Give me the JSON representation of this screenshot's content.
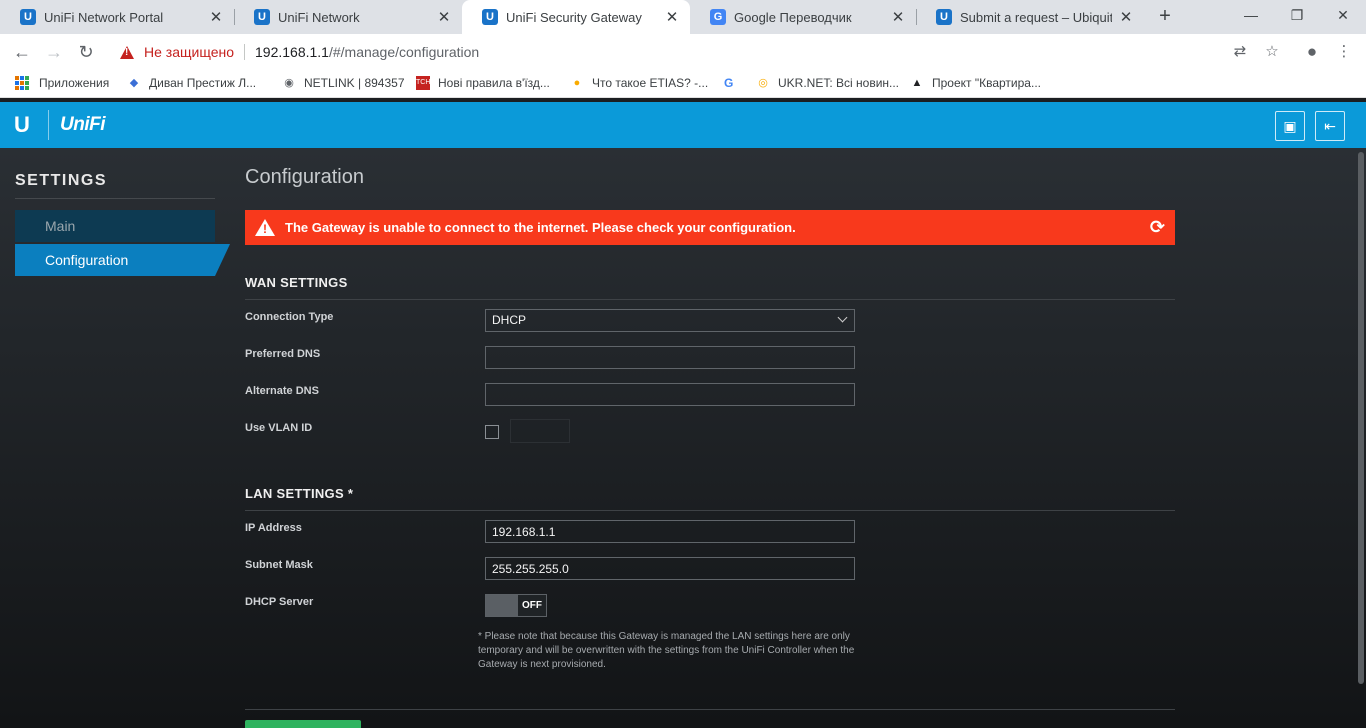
{
  "browser": {
    "tabs": [
      {
        "title": "UniFi Network Portal",
        "icon": "U"
      },
      {
        "title": "UniFi Network",
        "icon": "U"
      },
      {
        "title": "UniFi Security Gateway",
        "icon": "U"
      },
      {
        "title": "Google Переводчик",
        "icon": "G"
      },
      {
        "title": "Submit a request – Ubiquiti Ne",
        "icon": "U"
      }
    ],
    "security_label": "Не защищено",
    "url_host": "192.168.1.1",
    "url_path": "/#/manage/configuration",
    "bookmarks": [
      {
        "label": "Приложения"
      },
      {
        "label": "Диван Престиж Л..."
      },
      {
        "label": "NETLINK | 894357"
      },
      {
        "label": "Нові правила в'їзд..."
      },
      {
        "label": "Что такое ETIAS? -..."
      },
      {
        "label": "G"
      },
      {
        "label": "UKR.NET: Всі новин..."
      },
      {
        "label": "Проект \"Квартира..."
      }
    ]
  },
  "header": {
    "brand": "UniFi",
    "logo": "U"
  },
  "sidebar": {
    "title": "SETTINGS",
    "items": [
      {
        "label": "Main"
      },
      {
        "label": "Configuration"
      }
    ]
  },
  "main": {
    "title": "Configuration",
    "alert": "The Gateway is unable to connect to the internet. Please check your configuration.",
    "wan": {
      "title": "WAN SETTINGS",
      "connection_type_label": "Connection Type",
      "connection_type_value": "DHCP",
      "preferred_dns_label": "Preferred DNS",
      "preferred_dns_value": "",
      "alternate_dns_label": "Alternate DNS",
      "alternate_dns_value": "",
      "vlan_label": "Use VLAN ID"
    },
    "lan": {
      "title": "LAN SETTINGS *",
      "ip_label": "IP Address",
      "ip_value": "192.168.1.1",
      "subnet_label": "Subnet Mask",
      "subnet_value": "255.255.255.0",
      "dhcp_label": "DHCP Server",
      "dhcp_state": "OFF",
      "note": "* Please note that because this Gateway is managed the LAN settings here are only temporary and will be overwritten with the settings from the UniFi Controller when the Gateway is next provisioned."
    }
  },
  "colors": {
    "header_blue": "#0b9ad9",
    "alert_red": "#f8391c",
    "active_nav": "#0b7fbf",
    "save_green": "#2fb35f"
  }
}
